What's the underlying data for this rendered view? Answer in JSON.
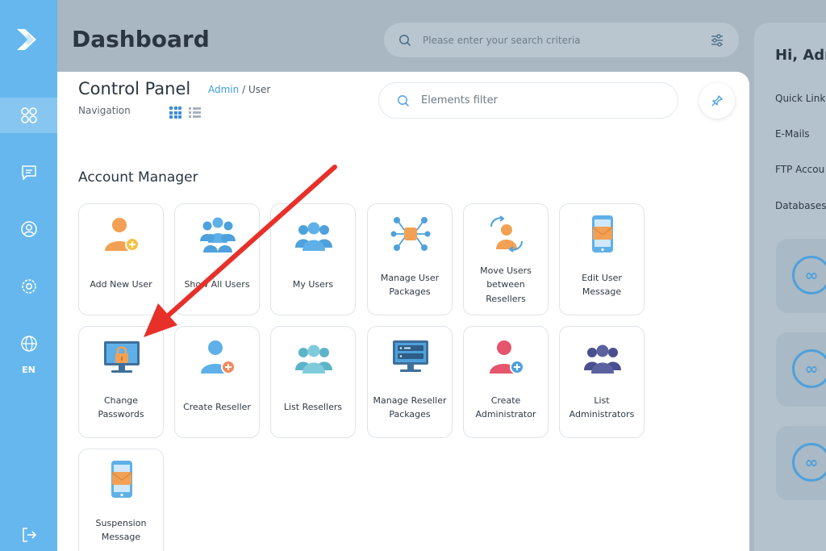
{
  "sidebar": {
    "items": [
      {
        "name": "dashboard",
        "icon": "grid-icon",
        "active": true
      },
      {
        "name": "messages",
        "icon": "chat-icon"
      },
      {
        "name": "account",
        "icon": "user-circle-icon"
      },
      {
        "name": "settings",
        "icon": "gear-icon"
      },
      {
        "name": "language",
        "icon": "globe-icon"
      }
    ],
    "language": "EN",
    "logout_icon": "logout-icon"
  },
  "header": {
    "title": "Dashboard",
    "search_placeholder": "Please enter your search criteria"
  },
  "control_panel": {
    "title": "Control Panel",
    "breadcrumb_admin": "Admin",
    "breadcrumb_sep": "/",
    "breadcrumb_user": "User",
    "navigation_label": "Navigation",
    "filter_placeholder": "Elements filter"
  },
  "section": {
    "title": "Account Manager",
    "tiles": [
      {
        "label": "Add New User",
        "icon": "add-user-icon"
      },
      {
        "label": "Show All Users",
        "icon": "users-group-icon"
      },
      {
        "label": "My Users",
        "icon": "users-icon"
      },
      {
        "label": "Manage User Packages",
        "icon": "packages-icon"
      },
      {
        "label": "Move Users between Resellers",
        "icon": "move-user-icon"
      },
      {
        "label": "Edit User Message",
        "icon": "phone-message-icon"
      },
      {
        "label": "Change Passwords",
        "icon": "monitor-lock-icon"
      },
      {
        "label": "Create Reseller",
        "icon": "create-reseller-icon"
      },
      {
        "label": "List Resellers",
        "icon": "resellers-group-icon"
      },
      {
        "label": "Manage Reseller Packages",
        "icon": "server-monitor-icon"
      },
      {
        "label": "Create Administrator",
        "icon": "create-admin-icon"
      },
      {
        "label": "List Administrators",
        "icon": "admins-group-icon"
      },
      {
        "label": "Suspension Message",
        "icon": "phone-message-icon"
      }
    ]
  },
  "right_panel": {
    "greeting": "Hi, Adm",
    "links": [
      "Quick Link",
      "E-Mails",
      "FTP Accou",
      "Databases"
    ]
  },
  "colors": {
    "sidebar": "#66b7ee",
    "accent": "#3d9de0",
    "arrow": "#e8302a",
    "orange": "#f2a154"
  }
}
